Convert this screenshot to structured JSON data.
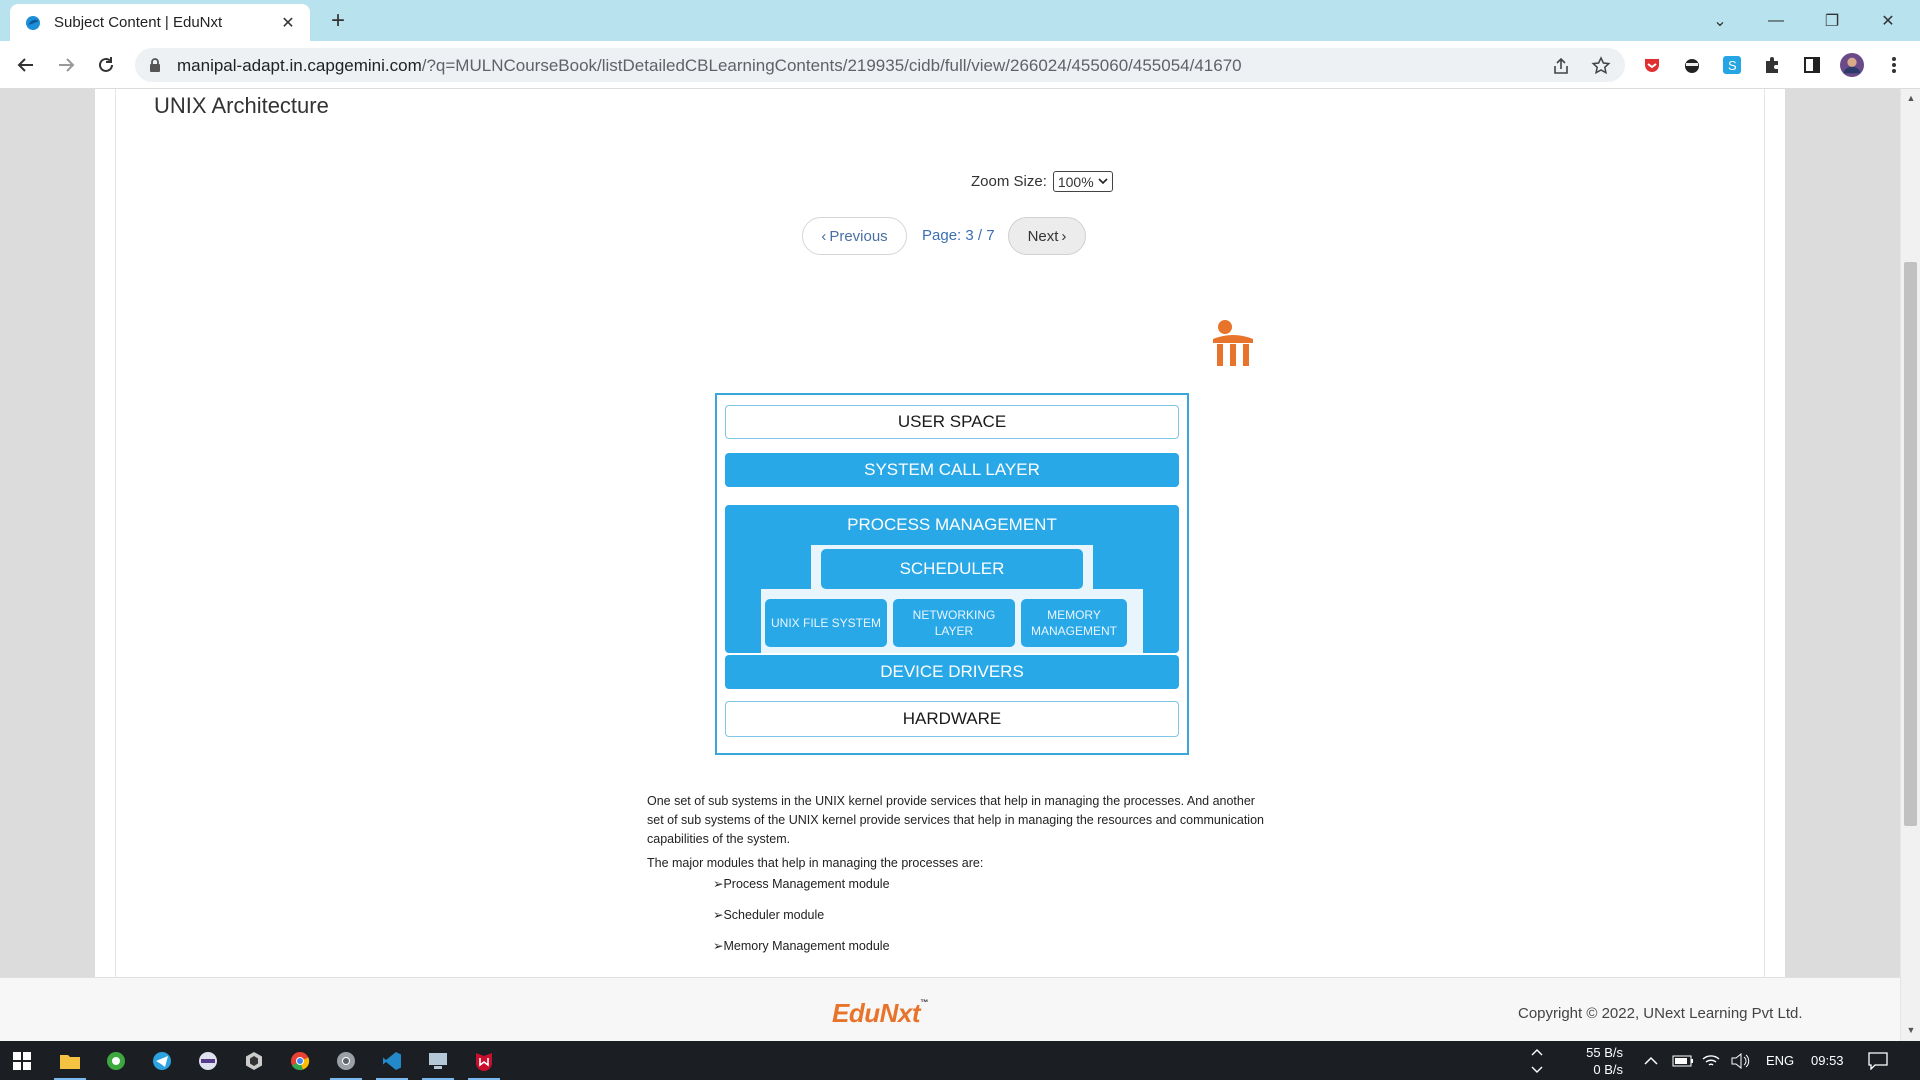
{
  "browser": {
    "tab_title": "Subject Content | EduNxt",
    "url_host": "manipal-adapt.in.capgemini.com",
    "url_path": "/?q=MULNCourseBook/listDetailedCBLearningContents/219935/cidb/full/view/266024/455060/455054/41670"
  },
  "page": {
    "title": "UNIX Architecture",
    "zoom_label": "Zoom Size:",
    "zoom_value": "100%",
    "prev_label": "Previous",
    "page_indicator": "Page: 3 / 7",
    "next_label": "Next"
  },
  "diagram": {
    "user_space": "USER SPACE",
    "system_call": "SYSTEM CALL LAYER",
    "process_mgmt": "PROCESS MANAGEMENT",
    "scheduler": "SCHEDULER",
    "unix_fs": "UNIX FILE SYSTEM",
    "networking_l1": "NETWORKING",
    "networking_l2": "LAYER",
    "memory_l1": "MEMORY",
    "memory_l2": "MANAGEMENT",
    "device_drivers": "DEVICE DRIVERS",
    "hardware": "HARDWARE"
  },
  "text": {
    "para1": "One set of sub systems in the UNIX kernel provide services that help in managing the processes. And another set of sub systems of the UNIX kernel provide services that help in managing the resources and communication capabilities of the system.",
    "para2": "The major modules that help in managing the processes are:",
    "bullets": [
      "➢Process Management module",
      "➢Scheduler module",
      "➢Memory Management module"
    ]
  },
  "footer": {
    "logo": "EduNxt",
    "copyright": "Copyright © 2022, UNext Learning Pvt Ltd."
  },
  "taskbar": {
    "net_up": "55 B/s",
    "net_down": "0 B/s",
    "lang": "ENG",
    "time": "09:53"
  },
  "colors": {
    "tabbar": "#b8e3ee",
    "diagram_blue": "#29a8e8",
    "brand_orange": "#e8742b",
    "link_blue": "#3c6fb4"
  }
}
